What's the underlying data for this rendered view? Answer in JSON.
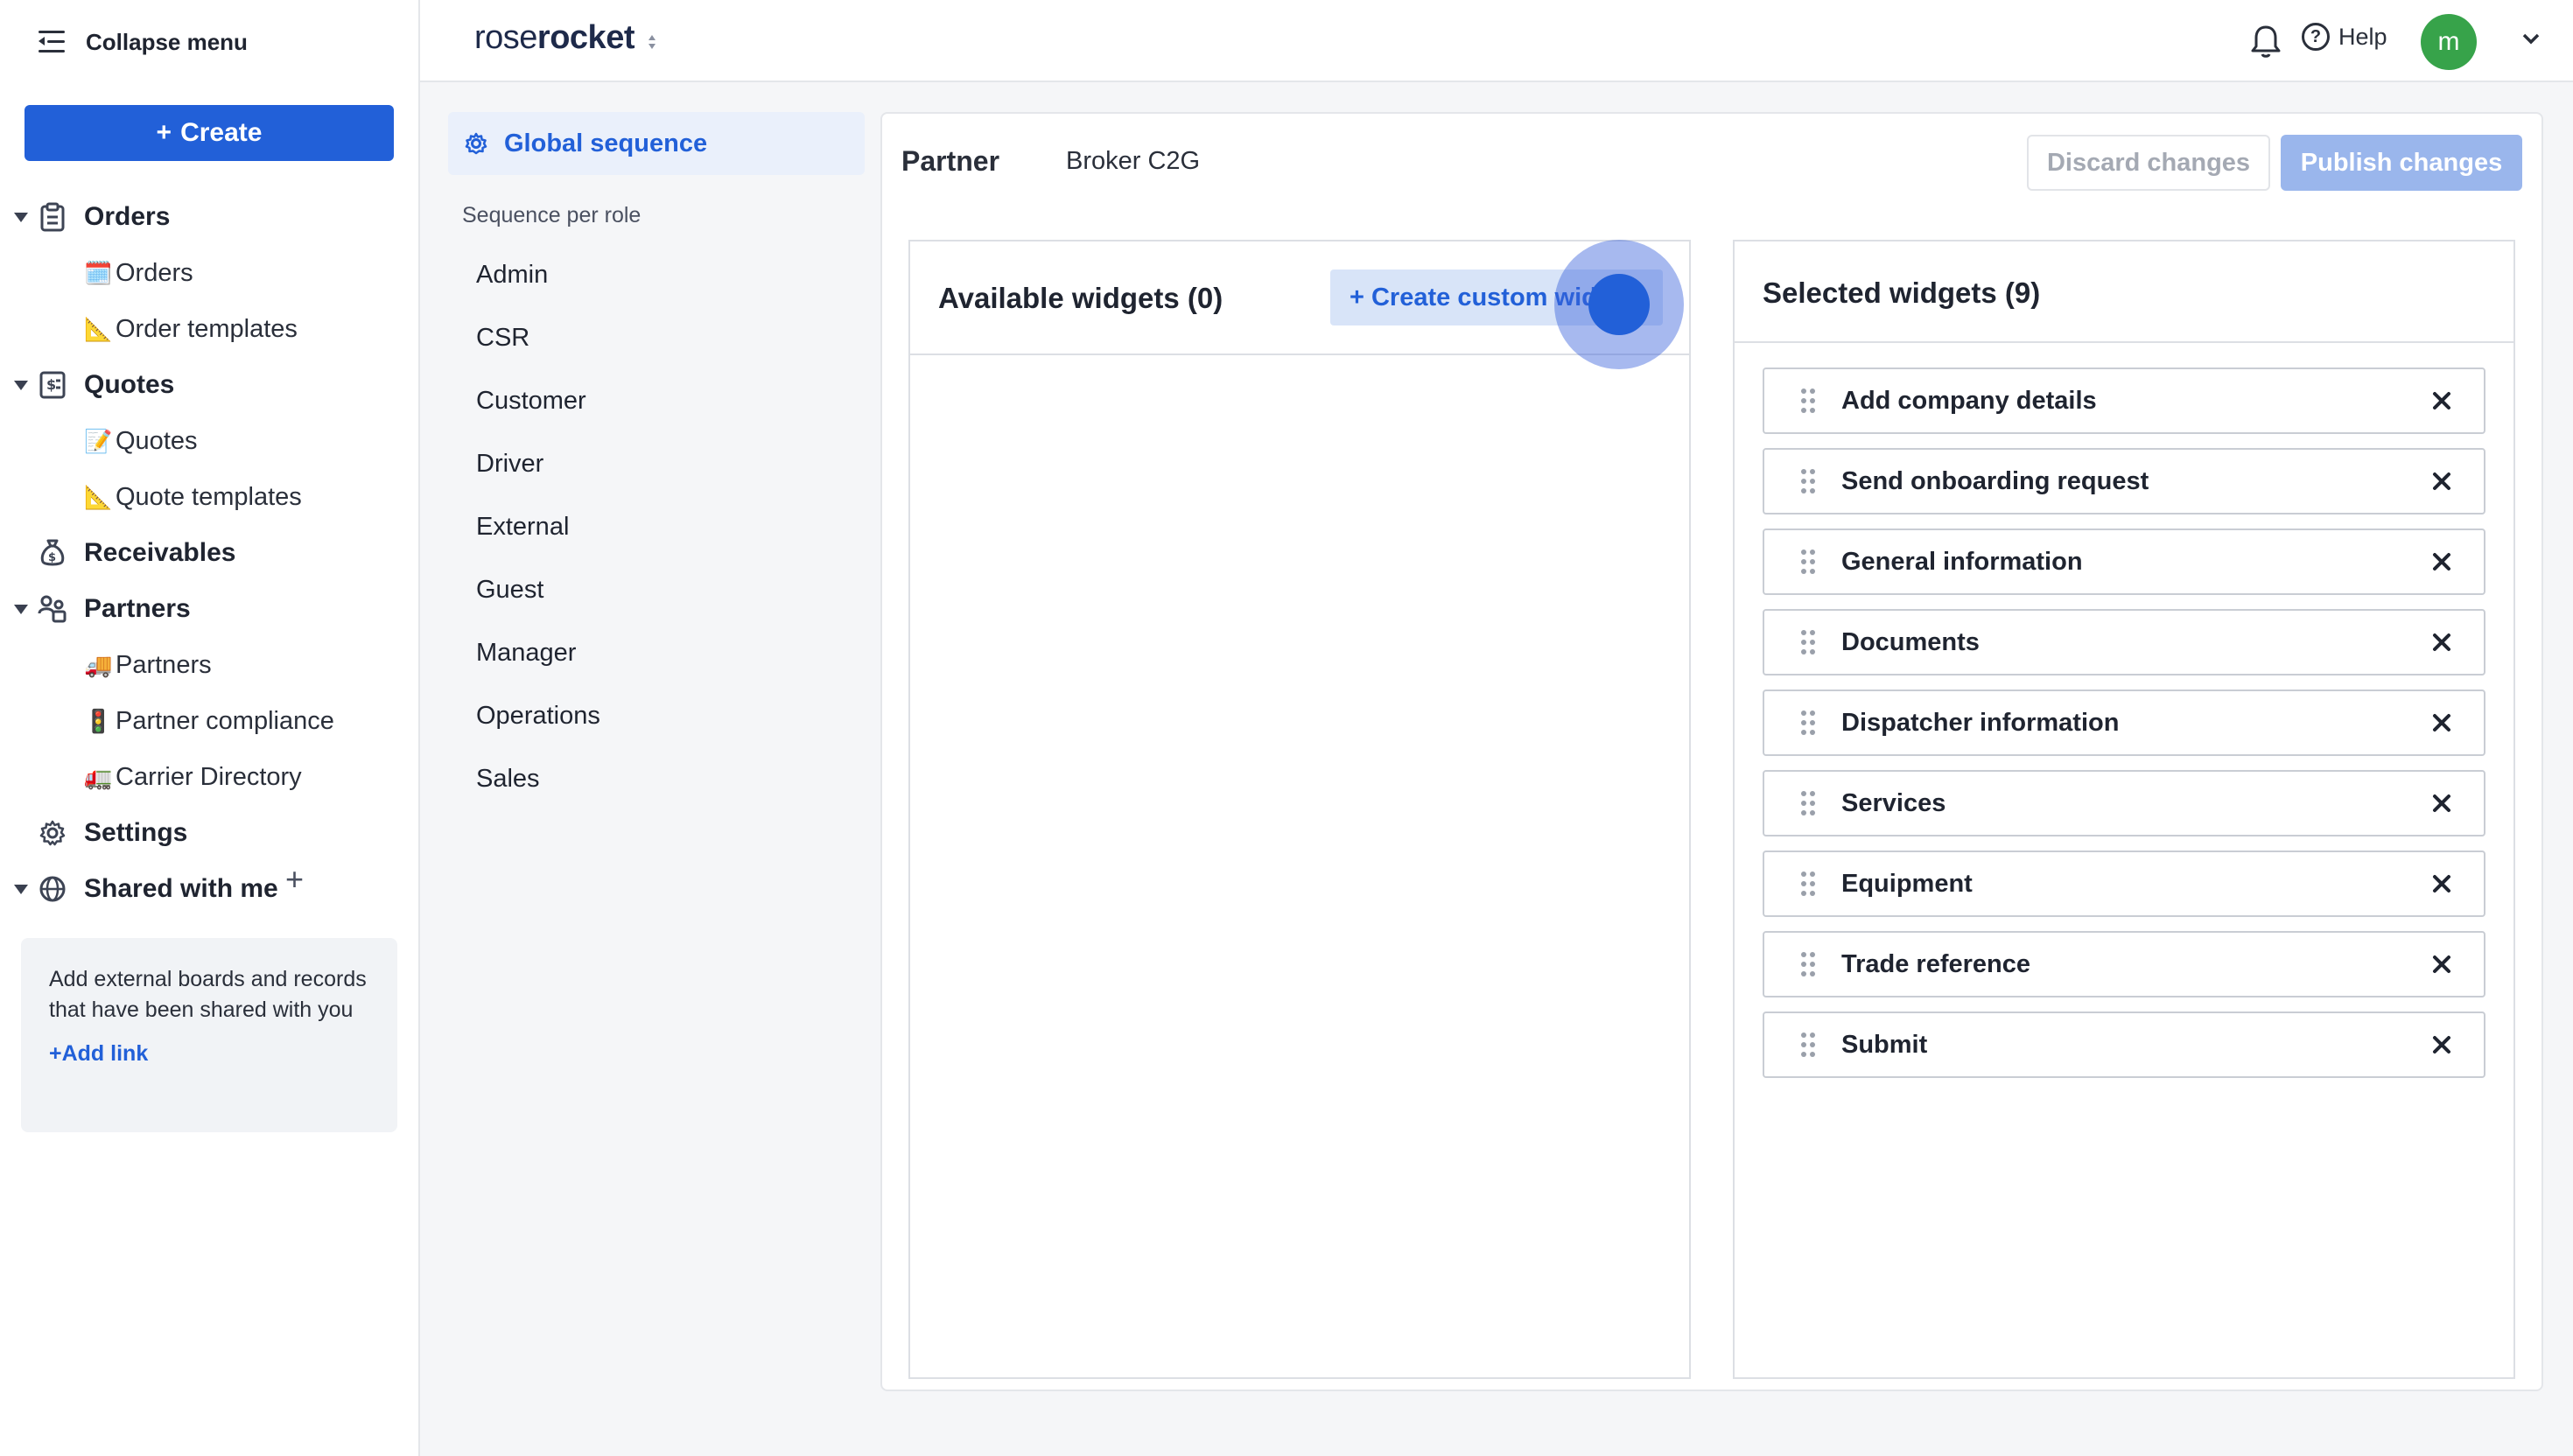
{
  "sidebar": {
    "collapse_label": "Collapse menu",
    "create_label": "Create",
    "orders": {
      "label": "Orders",
      "items": [
        {
          "emoji": "🗓️",
          "label": "Orders"
        },
        {
          "emoji": "📐",
          "label": "Order templates"
        }
      ]
    },
    "quotes": {
      "label": "Quotes",
      "items": [
        {
          "emoji": "📝",
          "label": "Quotes"
        },
        {
          "emoji": "📐",
          "label": "Quote templates"
        }
      ]
    },
    "receivables": {
      "label": "Receivables"
    },
    "partners": {
      "label": "Partners",
      "items": [
        {
          "emoji": "🚚",
          "label": "Partners"
        },
        {
          "emoji": "🚦",
          "label": "Partner compliance"
        },
        {
          "emoji": "🚛",
          "label": "Carrier Directory"
        }
      ]
    },
    "settings": {
      "label": "Settings"
    },
    "shared": {
      "label": "Shared with me",
      "description": "Add external boards and records that have been shared with you",
      "add_link": "Add link"
    }
  },
  "topbar": {
    "logo_light": "rose",
    "logo_bold": "rocket",
    "help_label": "Help",
    "avatar_initial": "m"
  },
  "sequence": {
    "global_label": "Global sequence",
    "per_role_heading": "Sequence per role",
    "roles": [
      "Admin",
      "CSR",
      "Customer",
      "Driver",
      "External",
      "Guest",
      "Manager",
      "Operations",
      "Sales"
    ]
  },
  "main": {
    "partner_label": "Partner",
    "partner_value": "Broker C2G",
    "discard_label": "Discard changes",
    "publish_label": "Publish changes",
    "available_title": "Available widgets (0)",
    "create_widget_label": "+ Create custom widget",
    "selected_title": "Selected widgets (9)",
    "selected_widgets": [
      "Add company details",
      "Send onboarding request",
      "General information",
      "Documents",
      "Dispatcher information",
      "Services",
      "Equipment",
      "Trade reference",
      "Submit"
    ]
  },
  "colors": {
    "primary": "#2260d8",
    "publish_disabled": "#9ab6ec",
    "avatar": "#37a34a",
    "active_bg": "#eaf0fb"
  },
  "icons": [
    "collapse-menu-icon",
    "clipboard-icon",
    "quote-icon",
    "money-bag-icon",
    "partners-icon",
    "gear-icon",
    "globe-icon",
    "plus-icon",
    "bell-icon",
    "help-icon",
    "chevron-down-icon",
    "drag-handle-icon",
    "close-icon"
  ]
}
